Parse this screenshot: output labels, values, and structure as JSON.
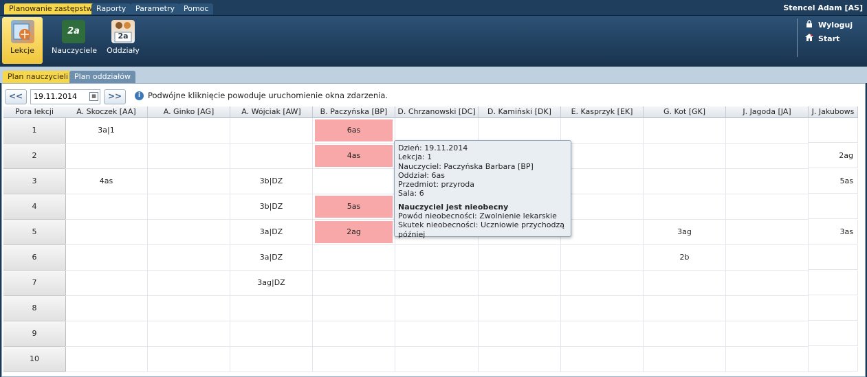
{
  "menu": {
    "tabs": [
      {
        "label": "Planowanie zastępstw",
        "active": true
      },
      {
        "label": "Raporty",
        "active": false
      },
      {
        "label": "Parametry",
        "active": false
      },
      {
        "label": "Pomoc",
        "active": false
      }
    ],
    "user": "Stencel Adam [AS]"
  },
  "ribbon": {
    "buttons": [
      {
        "label": "Lekcje",
        "icon": "lessons-icon",
        "active": true
      },
      {
        "label": "Nauczyciele",
        "icon": "teachers-icon",
        "icon_text": "2a",
        "active": false
      },
      {
        "label": "Oddziały",
        "icon": "classes-icon",
        "icon_text": "2a",
        "active": false
      }
    ],
    "logout": "Wyloguj",
    "start": "Start"
  },
  "subtabs": [
    {
      "label": "Plan nauczycieli",
      "active": true
    },
    {
      "label": "Plan oddziałów",
      "active": false
    }
  ],
  "toolbar": {
    "prev": "<<",
    "next": ">>",
    "date": "19.11.2014",
    "info": "Podwójne kliknięcie powoduje uruchomienie okna zdarzenia."
  },
  "schedule": {
    "row_header_title": "Pora lekcji",
    "teachers": [
      "A. Skoczek [AA]",
      "A. Ginko [AG]",
      "A. Wójciak [AW]",
      "B. Paczyńska [BP]",
      "D. Chrzanowski [DC]",
      "D. Kamiński [DK]",
      "E. Kasprzyk [EK]",
      "G. Kot [GK]",
      "J. Jagoda [JA]",
      "J. Jakubows"
    ],
    "periods": [
      "1",
      "2",
      "3",
      "4",
      "5",
      "6",
      "7",
      "8",
      "9",
      "10"
    ],
    "lessons": [
      [
        "3a|1",
        "",
        "",
        "6as",
        "",
        "",
        "",
        "",
        "",
        ""
      ],
      [
        "",
        "",
        "",
        "4as",
        "",
        "",
        "",
        "",
        "",
        "2ag"
      ],
      [
        "4as",
        "",
        "3b|DZ",
        "",
        "",
        "",
        "",
        "",
        "",
        "5as"
      ],
      [
        "",
        "",
        "3b|DZ",
        "5as",
        "",
        "",
        "",
        "",
        "",
        ""
      ],
      [
        "",
        "",
        "3a|DZ",
        "2ag",
        "",
        "",
        "",
        "3ag",
        "",
        "3as"
      ],
      [
        "",
        "",
        "3a|DZ",
        "",
        "",
        "",
        "",
        "2b",
        "",
        ""
      ],
      [
        "",
        "",
        "3ag|DZ",
        "",
        "",
        "",
        "",
        "",
        "",
        ""
      ],
      [
        "",
        "",
        "",
        "",
        "",
        "",
        "",
        "",
        "",
        ""
      ],
      [
        "",
        "",
        "",
        "",
        "",
        "",
        "",
        "",
        "",
        ""
      ],
      [
        "",
        "",
        "",
        "",
        "",
        "",
        "",
        "",
        "",
        ""
      ]
    ],
    "absent_cells": [
      [
        0,
        3
      ],
      [
        1,
        3
      ],
      [
        3,
        3
      ],
      [
        4,
        3
      ]
    ],
    "absent_color": "#f8a8a8"
  },
  "tooltip": {
    "lines": [
      "Dzień: 19.11.2014",
      "Lekcja: 1",
      "Nauczyciel: Paczyńska Barbara [BP]",
      "Oddział: 6as",
      "Przedmiot: przyroda",
      "Sala: 6"
    ],
    "status": "Nauczyciel jest nieobecny",
    "reason": "Powód nieobecności: Zwolnienie lekarskie",
    "effect": "Skutek nieobecności: Uczniowie przychodzą później"
  }
}
